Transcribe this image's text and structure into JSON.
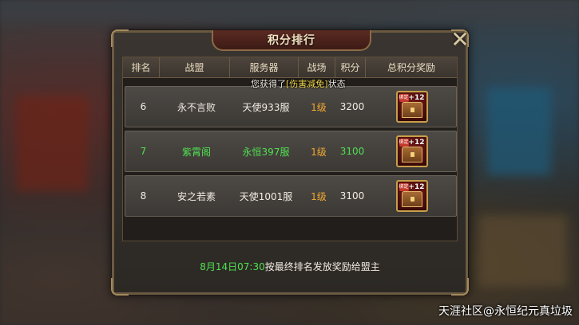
{
  "panel": {
    "title": "积分排行",
    "close_icon": "close-icon"
  },
  "table": {
    "headers": [
      "排名",
      "战盟",
      "服务器",
      "战场",
      "积分",
      "总积分奖励"
    ],
    "rows": [
      {
        "rank": "6",
        "guild": "永不言败",
        "server": "天使933服",
        "level": "1级",
        "score": "3200",
        "highlight": false
      },
      {
        "rank": "7",
        "guild": "紫霄阁",
        "server": "永恒397服",
        "level": "1级",
        "score": "3100",
        "highlight": true
      },
      {
        "rank": "8",
        "guild": "安之若素",
        "server": "天使1001服",
        "level": "1级",
        "score": "3100",
        "highlight": false
      }
    ],
    "reward": {
      "tag": "绑定",
      "plus": "+12"
    }
  },
  "tooltip": {
    "prefix": "您获得了",
    "highlight": "[伤害减免]",
    "suffix": "状态"
  },
  "footer": {
    "time": "8月14日07:30",
    "text": "按最终排名发放奖励给盟主"
  },
  "watermark": "天涯社区@永恒纪元真垃圾",
  "colors": {
    "highlight_green": "#4fe04f",
    "level_orange": "#f0a830",
    "tooltip_yellow": "#f5d94a"
  }
}
